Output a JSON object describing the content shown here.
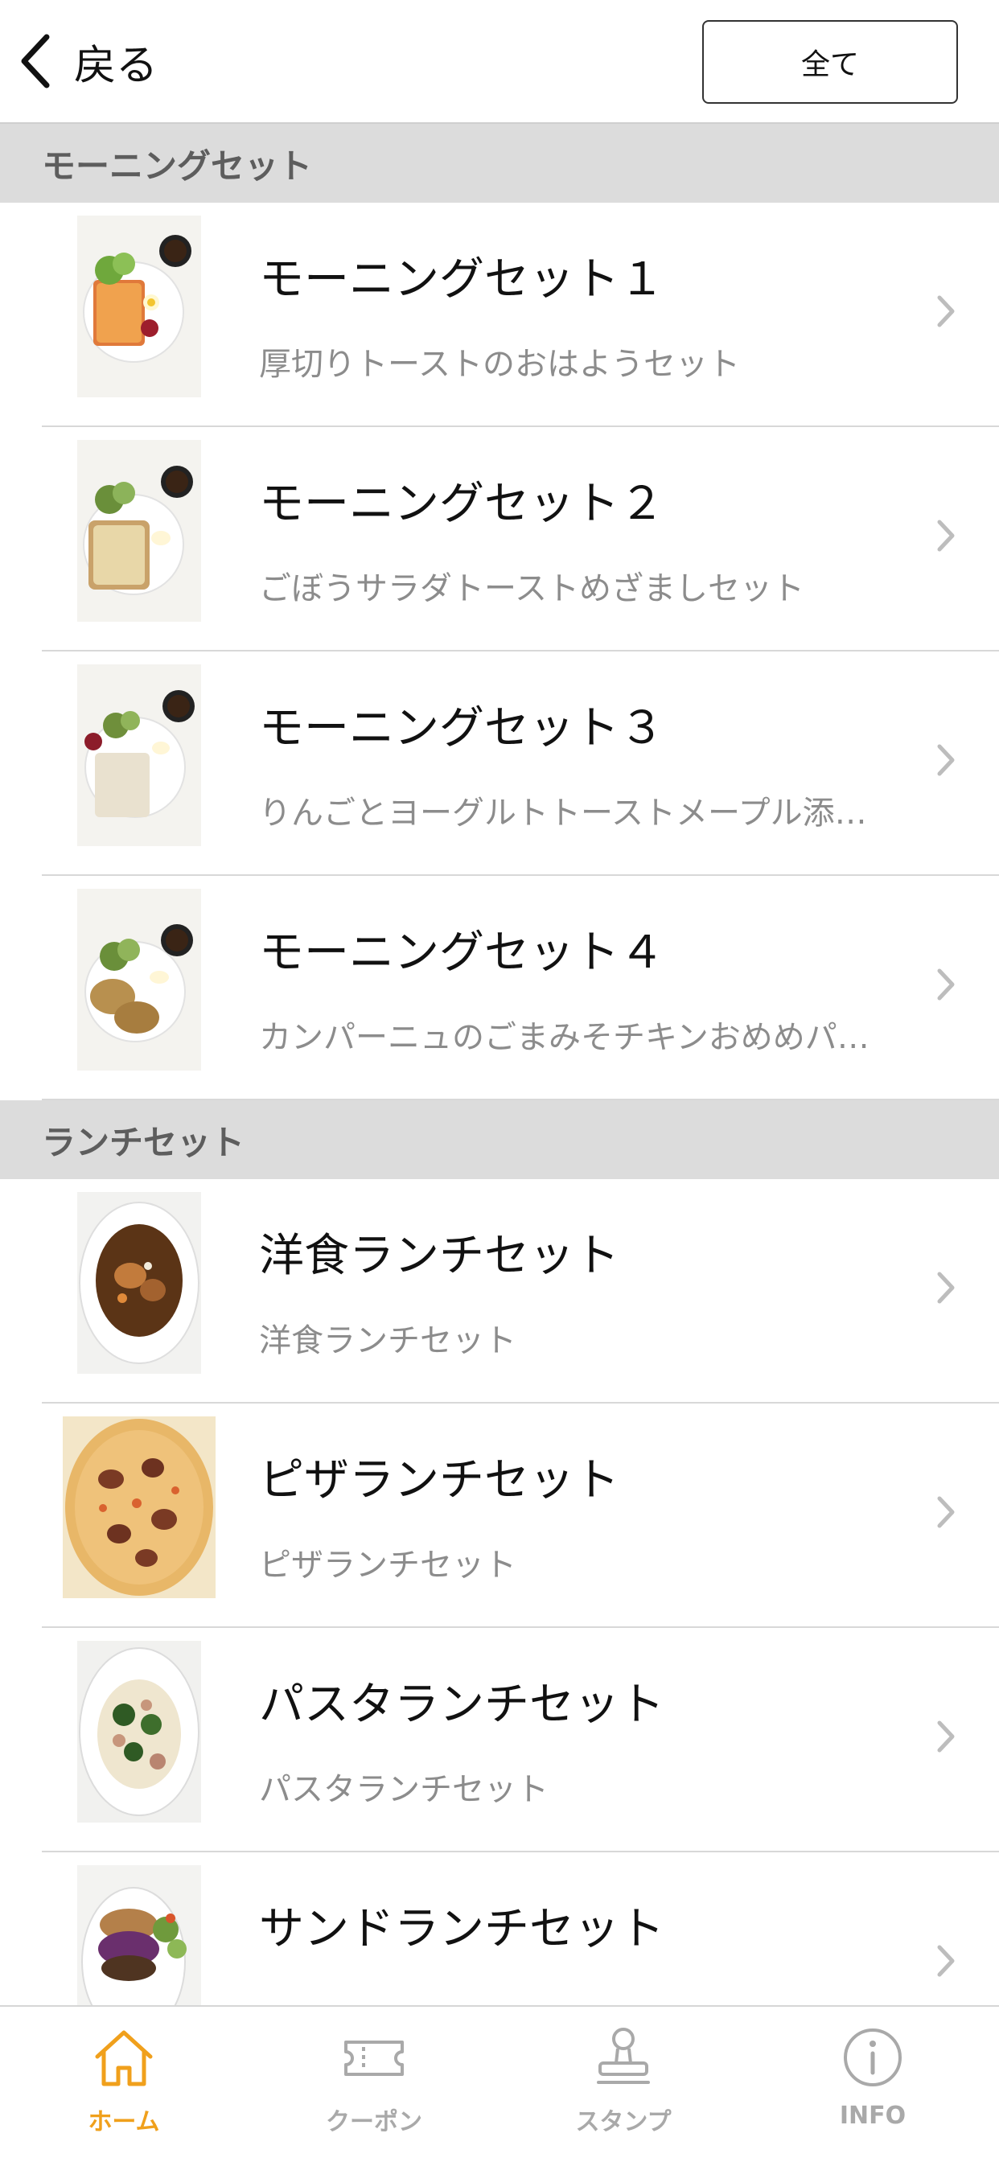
{
  "header": {
    "back_label": "戻る",
    "all_button": "全て"
  },
  "sections": [
    {
      "title": "モーニングセット",
      "items": [
        {
          "title": "モーニングセット１",
          "subtitle": "厚切りトーストのおはようセット"
        },
        {
          "title": "モーニングセット２",
          "subtitle": "ごぼうサラダトーストめざましセット"
        },
        {
          "title": "モーニングセット３",
          "subtitle": "りんごとヨーグルトトーストメープル添…"
        },
        {
          "title": "モーニングセット４",
          "subtitle": "カンパーニュのごまみそチキンおめめパ…"
        }
      ]
    },
    {
      "title": "ランチセット",
      "items": [
        {
          "title": "洋食ランチセット",
          "subtitle": "洋食ランチセット"
        },
        {
          "title": "ピザランチセット",
          "subtitle": "ピザランチセット"
        },
        {
          "title": "パスタランチセット",
          "subtitle": "パスタランチセット"
        },
        {
          "title": "サンドランチセット",
          "subtitle": ""
        }
      ]
    }
  ],
  "tabbar": {
    "tabs": [
      {
        "label": "ホーム",
        "icon": "home-icon",
        "active": true
      },
      {
        "label": "クーポン",
        "icon": "ticket-icon",
        "active": false
      },
      {
        "label": "スタンプ",
        "icon": "stamp-icon",
        "active": false
      },
      {
        "label": "INFO",
        "icon": "info-icon",
        "active": false
      }
    ]
  },
  "colors": {
    "accent": "#f0a01c",
    "section_bg": "#dcdcdc",
    "subtitle": "#8c8c8c",
    "inactive_tab": "#a9a9a9"
  }
}
